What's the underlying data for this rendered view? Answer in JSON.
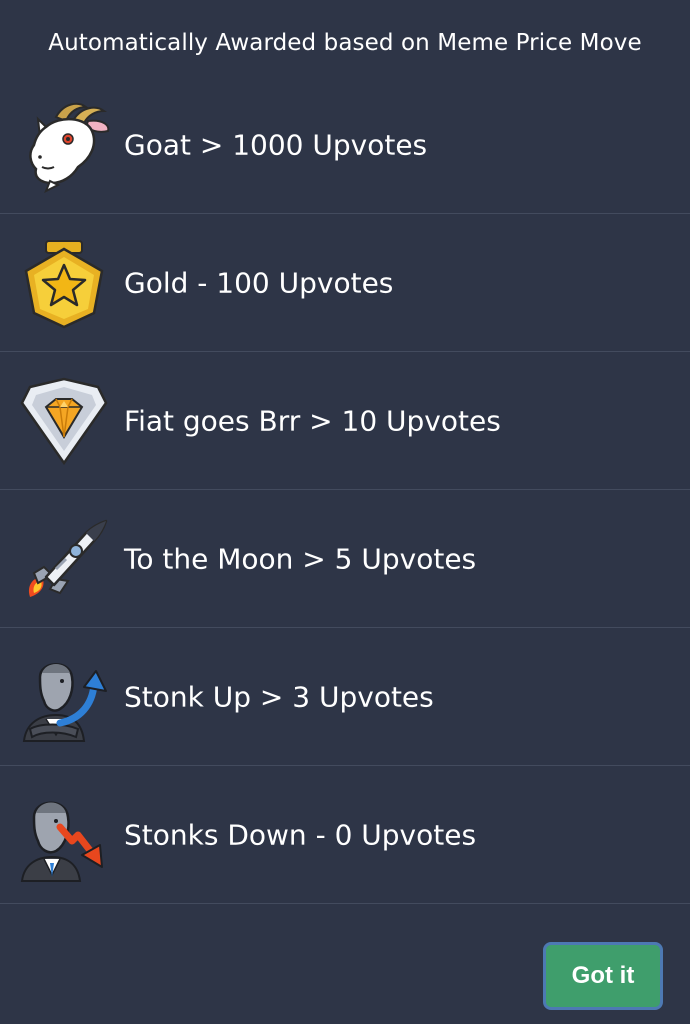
{
  "header": {
    "title": "Automatically Awarded based on Meme Price Move"
  },
  "awards": [
    {
      "label": "Goat > 1000 Upvotes",
      "icon": "goat-icon"
    },
    {
      "label": "Gold - 100 Upvotes",
      "icon": "gold-star-medal-icon"
    },
    {
      "label": "Fiat goes Brr > 10 Upvotes",
      "icon": "gem-shield-icon"
    },
    {
      "label": "To the Moon > 5 Upvotes",
      "icon": "rocket-icon"
    },
    {
      "label": "Stonk Up > 3 Upvotes",
      "icon": "stonk-up-icon"
    },
    {
      "label": "Stonks Down - 0 Upvotes",
      "icon": "stonks-down-icon"
    }
  ],
  "footer": {
    "confirm_label": "Got it"
  },
  "colors": {
    "background": "#2e3547",
    "divider": "#434b5e",
    "button_fill": "#3f9e6c",
    "button_border": "#4d79b3"
  }
}
